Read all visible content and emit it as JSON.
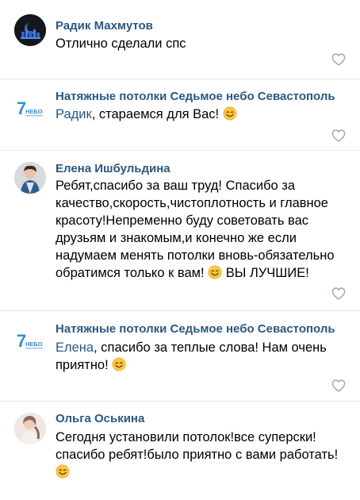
{
  "comments": [
    {
      "author": "Радик Махмутов",
      "text": "Отлично сделали спс",
      "avatar_icon": "moon-city-avatar-icon"
    },
    {
      "author": "Натяжные потолки Седьмое небо Севастополь",
      "mention": "Радик",
      "text": ", стараемся для Вас!",
      "avatar_icon": "brand-logo-7-nebo-icon",
      "logo_text": "7НЕБО"
    },
    {
      "author": "Елена Ишбульдина",
      "text": "Ребят,спасибо за ваш труд! Спасибо за качество,скорость,чистоплотность и главное красоту!Непременно буду советовать вас друзьям и знакомым,и конечно же если надумаем менять потолки вновь-обязательно обратимся только к вам!",
      "text_after_emoji": " ВЫ ЛУЧШИЕ!",
      "avatar_icon": "woman-photo-avatar-icon"
    },
    {
      "author": "Натяжные потолки Седьмое небо Севастополь",
      "mention": "Елена",
      "text": ", спасибо за теплые слова! Нам очень приятно!",
      "avatar_icon": "brand-logo-7-nebo-icon",
      "logo_text": "7НЕБО"
    },
    {
      "author": "Ольга Оськина",
      "text": "Сегодня установили потолок!все суперски! спасибо ребят!было приятно с вами работать!",
      "avatar_icon": "woman-photo-avatar-icon"
    }
  ],
  "colors": {
    "author_link": "#2a5885",
    "divider": "#e7e8ec",
    "like_icon": "#a8adb3",
    "emoji": "#ffc83d"
  }
}
